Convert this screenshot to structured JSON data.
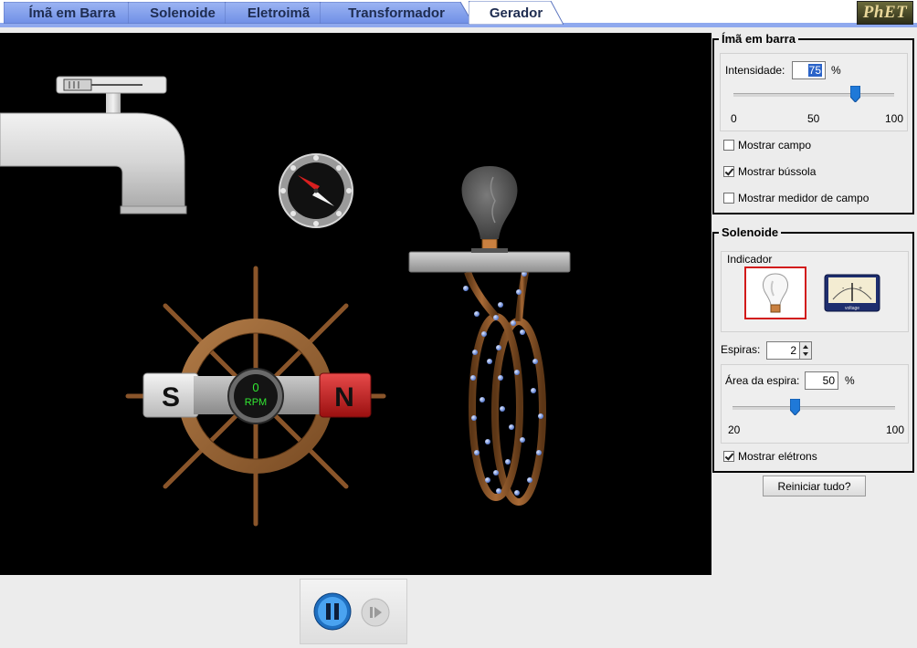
{
  "tabs": [
    {
      "label": "Ímã em Barra",
      "active": false
    },
    {
      "label": "Solenoide",
      "active": false
    },
    {
      "label": "Eletroimã",
      "active": false
    },
    {
      "label": "Transformador",
      "active": false
    },
    {
      "label": "Gerador",
      "active": true
    }
  ],
  "logo_text": "PhET",
  "rpm_meter": {
    "value": "0",
    "unit": "RPM"
  },
  "magnet": {
    "south_label": "S",
    "north_label": "N"
  },
  "bar_magnet_panel": {
    "title": "Ímã em barra",
    "strength_label": "Intensidade:",
    "strength_value": "75",
    "strength_unit": "%",
    "strength_level": 75,
    "scale_min": "0",
    "scale_mid": "50",
    "scale_max": "100",
    "show_field": {
      "label": "Mostrar campo",
      "checked": false
    },
    "show_compass": {
      "label": "Mostrar bússola",
      "checked": true
    },
    "show_field_meter": {
      "label": "Mostrar medidor de campo",
      "checked": false
    }
  },
  "solenoid_panel": {
    "title": "Solenoide",
    "indicator_label": "Indicador",
    "indicator_options": [
      {
        "icon": "lightbulb-icon",
        "selected": true
      },
      {
        "icon": "voltmeter-icon",
        "label": "voltage",
        "selected": false
      }
    ],
    "loops_label": "Espiras:",
    "loops_value": "2",
    "loop_area_label": "Área da espira:",
    "loop_area_value": "50",
    "loop_area_unit": "%",
    "loop_area_level": 50,
    "area_min": "20",
    "area_max": "100",
    "show_electrons": {
      "label": "Mostrar elétrons",
      "checked": true
    }
  },
  "reset_button": "Reiniciar tudo?",
  "clock_controls": {
    "pause": "pause-icon",
    "step": "step-icon"
  }
}
